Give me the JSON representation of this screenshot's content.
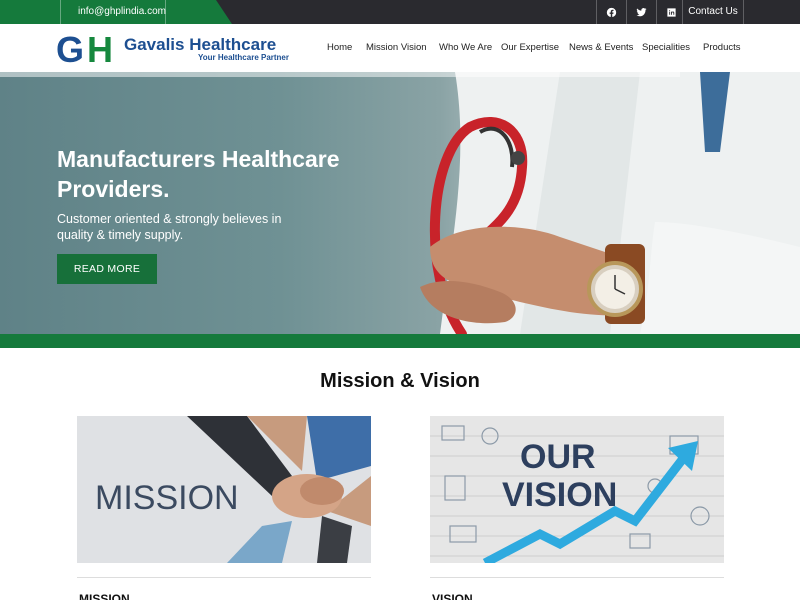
{
  "topbar": {
    "email": "info@ghplindia.com",
    "social": [
      {
        "icon": "facebook-icon"
      },
      {
        "icon": "twitter-icon"
      },
      {
        "icon": "linkedin-icon"
      }
    ],
    "contact_label": "Contact Us"
  },
  "brand": {
    "mark": "GH",
    "name": "Gavalis Healthcare",
    "tagline": "Your Healthcare Partner",
    "colors": {
      "blue": "#1d4f91",
      "green": "#16883e"
    }
  },
  "nav": {
    "items": [
      {
        "label": "Home"
      },
      {
        "label": "Mission Vision"
      },
      {
        "label": "Who We Are"
      },
      {
        "label": "Our Expertise"
      },
      {
        "label": "News & Events"
      },
      {
        "label": "Specialities"
      },
      {
        "label": "Products"
      }
    ]
  },
  "hero": {
    "title": "Manufacturers Healthcare Providers.",
    "subtitle": "Customer oriented & strongly believes in quality & timely supply.",
    "button_label": "READ MORE"
  },
  "section": {
    "title": "Mission & Vision",
    "cards": [
      {
        "image_text": "MISSION",
        "heading": "MISSION"
      },
      {
        "image_text_1": "OUR",
        "image_text_2": "VISION",
        "heading": "VISION"
      }
    ]
  },
  "colors": {
    "accent_green": "#157a3c",
    "topbar_dark": "#2a2a2f"
  }
}
